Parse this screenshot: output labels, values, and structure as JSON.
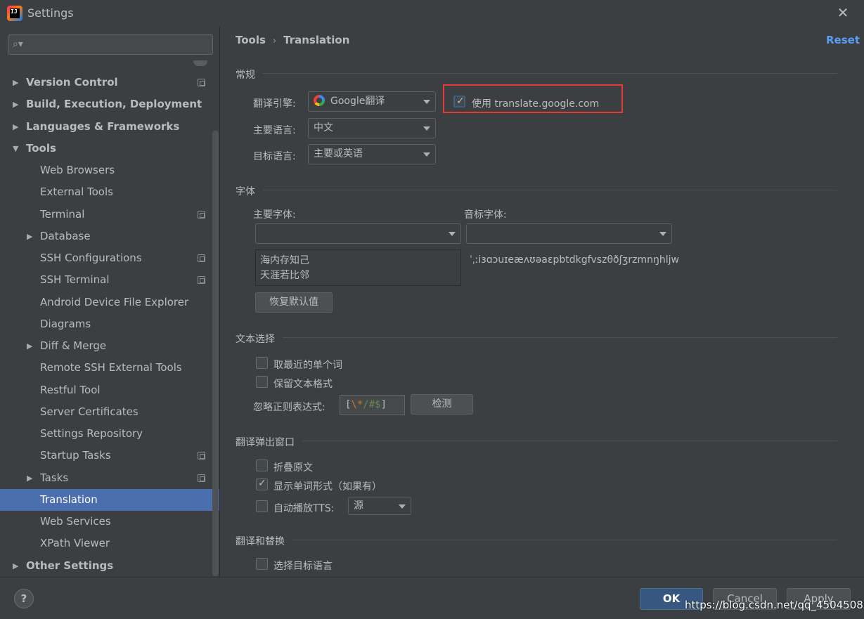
{
  "window": {
    "title": "Settings",
    "close_glyph": "✕"
  },
  "search": {
    "placeholder": "",
    "icon": "search-icon"
  },
  "tree": [
    {
      "label": "Version Control",
      "level": 0,
      "expandable": true,
      "expanded": false,
      "project": true
    },
    {
      "label": "Build, Execution, Deployment",
      "level": 0,
      "expandable": true,
      "expanded": false,
      "project": false
    },
    {
      "label": "Languages & Frameworks",
      "level": 0,
      "expandable": true,
      "expanded": false,
      "project": false
    },
    {
      "label": "Tools",
      "level": 0,
      "expandable": true,
      "expanded": true,
      "project": false
    },
    {
      "label": "Web Browsers",
      "level": 1,
      "expandable": false,
      "project": false
    },
    {
      "label": "External Tools",
      "level": 1,
      "expandable": false,
      "project": false
    },
    {
      "label": "Terminal",
      "level": 1,
      "expandable": false,
      "project": true
    },
    {
      "label": "Database",
      "level": 1,
      "expandable": true,
      "expanded": false,
      "project": false
    },
    {
      "label": "SSH Configurations",
      "level": 1,
      "expandable": false,
      "project": true
    },
    {
      "label": "SSH Terminal",
      "level": 1,
      "expandable": false,
      "project": true
    },
    {
      "label": "Android Device File Explorer",
      "level": 1,
      "expandable": false,
      "project": false
    },
    {
      "label": "Diagrams",
      "level": 1,
      "expandable": false,
      "project": false
    },
    {
      "label": "Diff & Merge",
      "level": 1,
      "expandable": true,
      "expanded": false,
      "project": false
    },
    {
      "label": "Remote SSH External Tools",
      "level": 1,
      "expandable": false,
      "project": false
    },
    {
      "label": "Restful Tool",
      "level": 1,
      "expandable": false,
      "project": false
    },
    {
      "label": "Server Certificates",
      "level": 1,
      "expandable": false,
      "project": false
    },
    {
      "label": "Settings Repository",
      "level": 1,
      "expandable": false,
      "project": false
    },
    {
      "label": "Startup Tasks",
      "level": 1,
      "expandable": false,
      "project": true
    },
    {
      "label": "Tasks",
      "level": 1,
      "expandable": true,
      "expanded": false,
      "project": true
    },
    {
      "label": "Translation",
      "level": 1,
      "expandable": false,
      "project": false,
      "selected": true
    },
    {
      "label": "Web Services",
      "level": 1,
      "expandable": false,
      "project": false
    },
    {
      "label": "XPath Viewer",
      "level": 1,
      "expandable": false,
      "project": false
    },
    {
      "label": "Other Settings",
      "level": 0,
      "expandable": true,
      "expanded": false,
      "project": false
    }
  ],
  "breadcrumb": {
    "parent": "Tools",
    "separator": "›",
    "current": "Translation"
  },
  "reset_label": "Reset",
  "general": {
    "title": "常规",
    "engine_label": "翻译引擎:",
    "engine_value": "Google翻译",
    "use_google_com_label": "使用 translate.google.com",
    "use_google_com_checked": true,
    "primary_lang_label": "主要语言:",
    "primary_lang_value": "中文",
    "target_lang_label": "目标语言:",
    "target_lang_value": "主要或英语"
  },
  "font": {
    "title": "字体",
    "primary_font_label": "主要字体:",
    "phonetic_font_label": "音标字体:",
    "primary_font_value": "",
    "phonetic_font_value": "",
    "preview_line1": "海内存知己",
    "preview_line2": "天涯若比邻",
    "phonetic_preview": "ˈˌːiɜɑɔuɪeæʌʊəaɛpbtdkgfvszθðʃʒrzmnŋhljw",
    "restore_label": "恢复默认值"
  },
  "selection": {
    "title": "文本选择",
    "nearest_word_label": "取最近的单个词",
    "nearest_word_checked": false,
    "keep_format_label": "保留文本格式",
    "keep_format_checked": false,
    "ignore_regex_label": "忽略正则表达式:",
    "regex_open": "[",
    "regex_esc": "\\*",
    "regex_mid": "/#$",
    "regex_close": "]",
    "check_label": "检测"
  },
  "popup": {
    "title": "翻译弹出窗口",
    "fold_label": "折叠原文",
    "fold_checked": false,
    "word_forms_label": "显示单词形式（如果有）",
    "word_forms_checked": true,
    "auto_tts_label": "自动播放TTS:",
    "auto_tts_checked": false,
    "tts_source_value": "源"
  },
  "replace": {
    "title": "翻译和替换",
    "select_target_label": "选择目标语言",
    "select_target_checked": false
  },
  "footer": {
    "help_label": "?",
    "ok_label": "OK",
    "cancel_label": "Cancel",
    "apply_label": "Apply",
    "watermark": "https://blog.csdn.net/qq_45045083"
  },
  "colors": {
    "accent": "#4b6eaf",
    "link": "#589df6",
    "highlight_box": "#e53935",
    "ok_button": "#365880"
  }
}
